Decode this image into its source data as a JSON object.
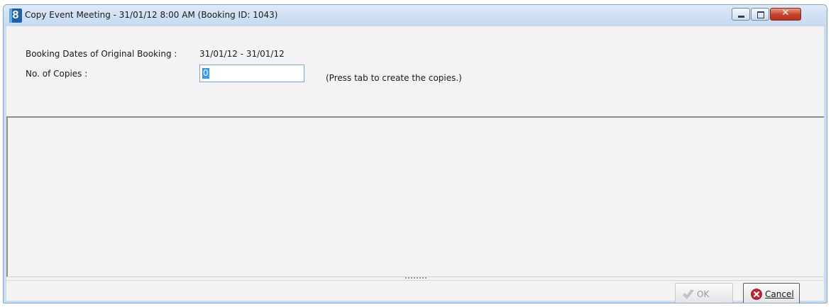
{
  "window": {
    "title": "Copy Event Meeting - 31/01/12 8:00 AM (Booking ID: 1043)",
    "app_icon_glyph": "8",
    "controls": {
      "minimize": "minimize-icon",
      "maximize": "maximize-icon",
      "close": "close-icon",
      "close_glyph": "✕"
    }
  },
  "form": {
    "original_dates_label": "Booking Dates of Original Booking :",
    "original_dates_value": "31/01/12 - 31/01/12",
    "copies_label": "No. of Copies :",
    "copies_value": "0",
    "hint": "(Press tab to create the copies.)"
  },
  "buttons": {
    "ok_label": "OK",
    "cancel_label": "Cancel"
  },
  "colors": {
    "title_bar": "#c5d9ef",
    "close_button": "#c7402a",
    "selection": "#3399ff",
    "client_bg": "#f3f3f3"
  }
}
